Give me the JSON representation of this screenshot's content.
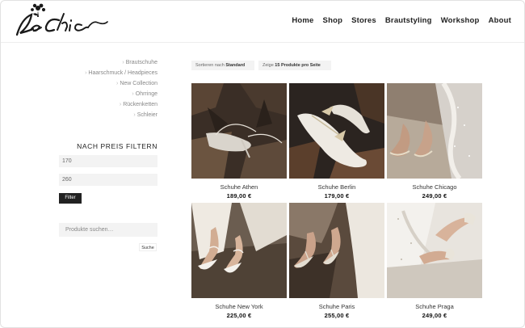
{
  "nav": {
    "items": [
      "Home",
      "Shop",
      "Stores",
      "Brautstyling",
      "Workshop",
      "About"
    ]
  },
  "sidebar": {
    "categories": [
      "Brautschuhe",
      "Haarschmuck / Headpieces",
      "New Collection",
      "Ohrringe",
      "Rückenketten",
      "Schleier"
    ],
    "filter_title": "NACH PREIS FILTERN",
    "min_price": "170",
    "max_price": "260",
    "filter_button": "Filter",
    "search_placeholder": "Produkte suchen…",
    "search_button": "Suche"
  },
  "sorting": {
    "sort_label": "Sortieren nach",
    "sort_value": "Standard",
    "show_label": "Zeige",
    "show_value": "15 Produkte pro Seite"
  },
  "products": [
    {
      "name": "Schuhe Athen",
      "price": "189,00 €"
    },
    {
      "name": "Schuhe Berlin",
      "price": "179,00 €"
    },
    {
      "name": "Schuhe Chicago",
      "price": "249,00 €"
    },
    {
      "name": "Schuhe New York",
      "price": "225,00 €"
    },
    {
      "name": "Schuhe Paris",
      "price": "255,00 €"
    },
    {
      "name": "Schuhe Praga",
      "price": "249,00 €"
    }
  ],
  "colors": {
    "text": "#333333",
    "muted": "#888888",
    "button": "#222222",
    "field": "#f3f3f3"
  }
}
